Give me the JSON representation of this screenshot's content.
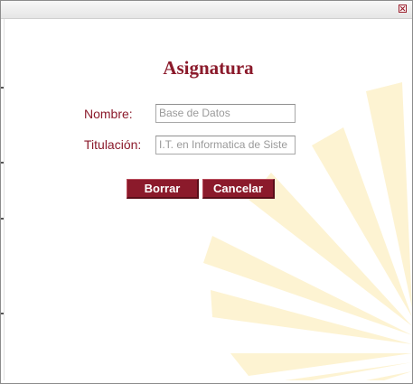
{
  "window": {
    "close_icon": "close-x-icon"
  },
  "form": {
    "title": "Asignatura",
    "fields": [
      {
        "label": "Nombre:",
        "value": "Base de Datos"
      },
      {
        "label": "Titulación:",
        "value": "I.T. en Informatica de Siste"
      }
    ],
    "buttons": {
      "delete_label": "Borrar",
      "cancel_label": "Cancelar"
    }
  },
  "colors": {
    "accent": "#8b1a2b",
    "watermark": "#fdf3d2"
  }
}
